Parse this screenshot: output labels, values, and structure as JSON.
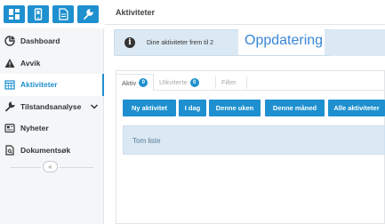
{
  "toolbar": {
    "icons": [
      "dashboard-icon",
      "mobile-icon",
      "document-icon",
      "wrench-icon"
    ]
  },
  "sidebar": {
    "items": [
      {
        "label": "Dashboard",
        "icon": "pie-chart-icon"
      },
      {
        "label": "Avvik",
        "icon": "warning-icon"
      },
      {
        "label": "Aktiviteter",
        "icon": "calendar-icon",
        "active": true
      },
      {
        "label": "Tilstandsanalyse",
        "icon": "wrench-icon",
        "has_children": true
      },
      {
        "label": "Nyheter",
        "icon": "newspaper-icon"
      },
      {
        "label": "Dokumentsøk",
        "icon": "file-search-icon"
      }
    ],
    "collapse_label": "«"
  },
  "header": {
    "title": "Aktiviteter"
  },
  "alert": {
    "text": "Dine aktiviteter frem til 2",
    "overlay": "Oppdatering"
  },
  "tabs": [
    {
      "label": "Aktiv",
      "count": "0"
    },
    {
      "label": "Utkviterte",
      "count": "0"
    },
    {
      "label": "Filter"
    }
  ],
  "buttons": [
    "Ny aktivitet",
    "I dag",
    "Denne uken",
    "Denne måned",
    "Alle aktiviteter"
  ],
  "list": {
    "empty_text": "Tom liste"
  },
  "colors": {
    "accent": "#1e90cf",
    "info_bg": "#dbe9f4",
    "overlay_text": "#3a86d8"
  }
}
